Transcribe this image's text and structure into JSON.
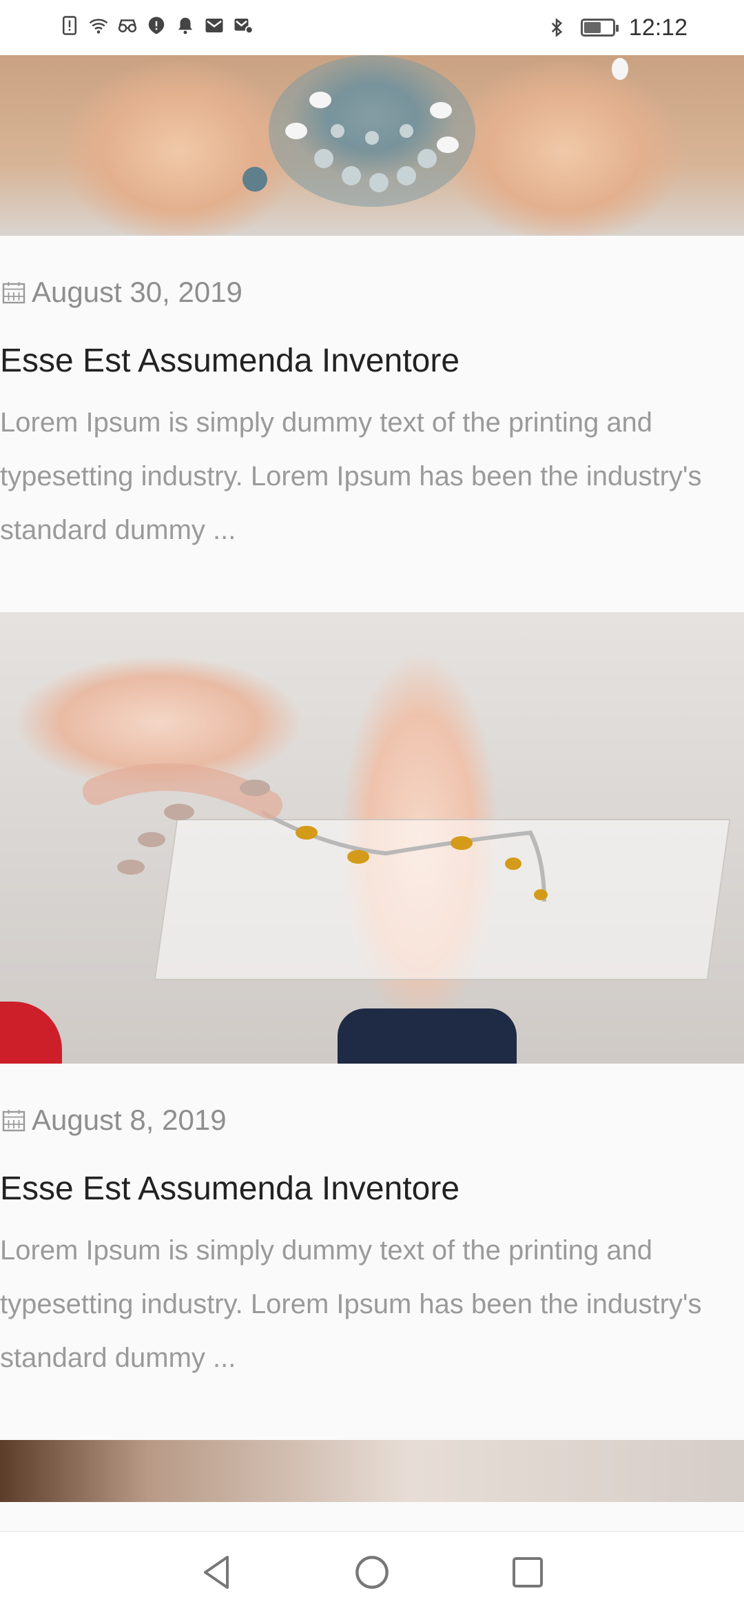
{
  "status_bar": {
    "time": "12:12",
    "battery_level": 0.55,
    "left_icons": [
      "alert-icon",
      "wifi-icon",
      "glasses-icon",
      "shield-icon",
      "bell-icon",
      "mail-icon",
      "mail-settings-icon"
    ],
    "right_icons": [
      "bluetooth-icon",
      "battery-icon"
    ]
  },
  "posts": [
    {
      "date": "August 30, 2019",
      "title": "Esse Est Assumenda Inventore",
      "excerpt": "Lorem Ipsum is simply dummy text of the printing and typesetting industry. Lorem Ipsum has been the industry's standard dummy ..."
    },
    {
      "date": "August 8, 2019",
      "title": "Esse Est Assumenda Inventore",
      "excerpt": "Lorem Ipsum is simply dummy text of the printing and typesetting industry. Lorem Ipsum has been the industry's standard dummy ..."
    }
  ],
  "nav_bar": {
    "buttons": [
      "back-icon",
      "home-icon",
      "recents-icon"
    ]
  },
  "colors": {
    "background": "#fafafa",
    "title": "#222222",
    "meta": "#8e8e8e",
    "excerpt": "#9a9a9a"
  }
}
